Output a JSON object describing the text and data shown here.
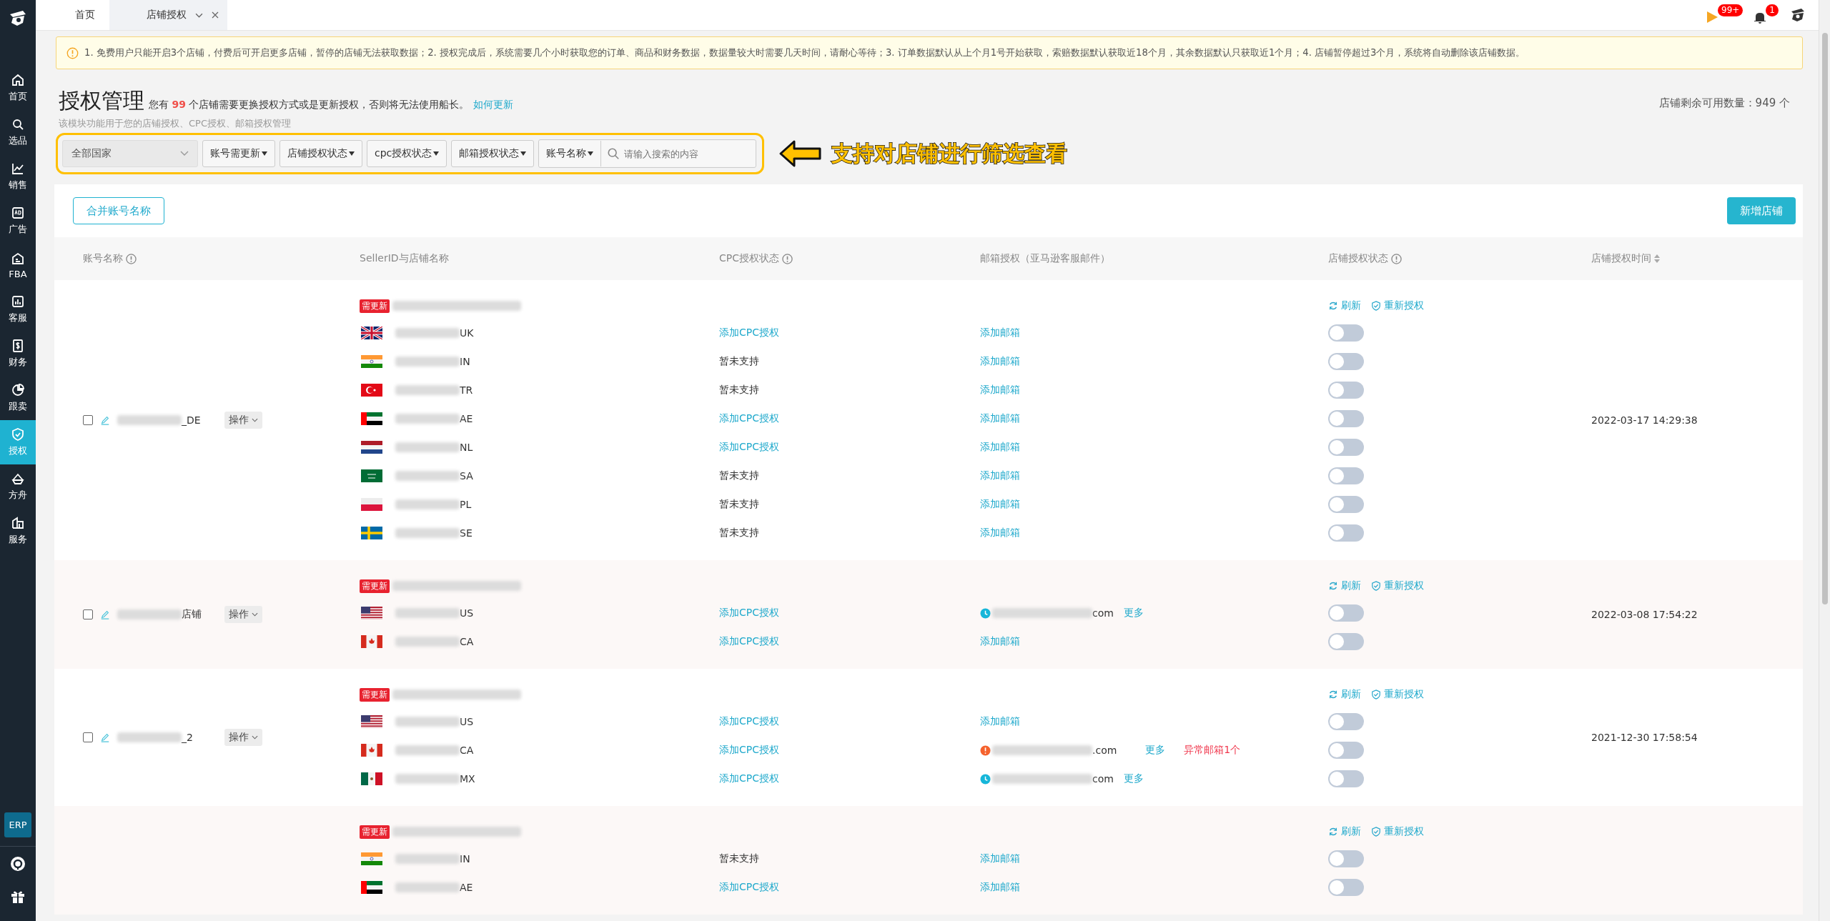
{
  "sidebar": {
    "items": [
      {
        "label": "首页",
        "selected": false
      },
      {
        "label": "选品",
        "selected": false
      },
      {
        "label": "销售",
        "selected": false
      },
      {
        "label": "广告",
        "selected": false
      },
      {
        "label": "FBA",
        "selected": false
      },
      {
        "label": "客服",
        "selected": false
      },
      {
        "label": "财务",
        "selected": false
      },
      {
        "label": "跟卖",
        "selected": false
      },
      {
        "label": "授权",
        "selected": true
      },
      {
        "label": "方舟",
        "selected": false
      },
      {
        "label": "服务",
        "selected": false
      }
    ],
    "erp": "ERP"
  },
  "tabs": [
    {
      "label": "首页",
      "selected": false
    },
    {
      "label": "店铺授权",
      "selected": true
    }
  ],
  "topbar": {
    "flag_badge": "99+",
    "bell_badge": "1"
  },
  "notice": "1. 免费用户只能开启3个店铺，付费后可开启更多店铺，暂停的店铺无法获取数据；2. 授权完成后，系统需要几个小时获取您的订单、商品和财务数据，数据量较大时需要几天时间，请耐心等待；3. 订单数据默认从上个月1号开始获取，索赔数据默认获取近18个月，其余数据默认只获取近1个月；4. 店铺暂停超过3个月，系统将自动删除该店铺数据。",
  "header": {
    "title": "授权管理",
    "message": "您有 **99** 个店铺需要更换授权方式或是更新授权，否则将无法使用船长。",
    "link": "如何更新",
    "description": "该模块功能用于您的店铺授权、CPC授权、邮箱授权管理",
    "quota": "店铺剩余可用数量：949 个"
  },
  "filters": {
    "country": "全部国家",
    "dropdowns": [
      "账号需更新",
      "店铺授权状态",
      "cpc授权状态",
      "邮箱授权状态"
    ],
    "search_scope": "账号名称",
    "search_placeholder": "请输入搜索的内容"
  },
  "annotation": "支持对店铺进行筛选查看",
  "buttons": {
    "merge": "合并账号名称",
    "add": "新增店铺"
  },
  "table": {
    "columns": [
      {
        "label": "账号名称",
        "kind": "info"
      },
      {
        "label": "SellerID与店铺名称",
        "kind": "plain"
      },
      {
        "label": "CPC授权状态",
        "kind": "info"
      },
      {
        "label": "邮箱授权（亚马逊客服邮件）",
        "kind": "plain"
      },
      {
        "label": "店铺授权状态",
        "kind": "info"
      },
      {
        "label": "店铺授权时间",
        "kind": "sort"
      }
    ]
  },
  "accounts": [
    {
      "selected": false,
      "name_suffix": "_DE",
      "action": "操作",
      "badge": "需更新",
      "refresh": "刷新",
      "reauth": "重新授权",
      "time": "2022-03-17 14:29:38",
      "shops": [
        {
          "kind": "uk",
          "suffix": "UK",
          "cpc": {
            "kind": "link",
            "text": "添加CPC授权"
          },
          "mail": {
            "kind": "add",
            "text": "添加邮箱"
          },
          "on": false
        },
        {
          "kind": "in",
          "suffix": "IN",
          "cpc": {
            "kind": "text",
            "text": "暂未支持"
          },
          "mail": {
            "kind": "add",
            "text": "添加邮箱"
          },
          "on": false
        },
        {
          "kind": "tr",
          "suffix": "TR",
          "cpc": {
            "kind": "text",
            "text": "暂未支持"
          },
          "mail": {
            "kind": "add",
            "text": "添加邮箱"
          },
          "on": false
        },
        {
          "kind": "ae",
          "suffix": "AE",
          "cpc": {
            "kind": "link",
            "text": "添加CPC授权"
          },
          "mail": {
            "kind": "add",
            "text": "添加邮箱"
          },
          "on": false
        },
        {
          "kind": "nl",
          "suffix": "NL",
          "cpc": {
            "kind": "link",
            "text": "添加CPC授权"
          },
          "mail": {
            "kind": "add",
            "text": "添加邮箱"
          },
          "on": false
        },
        {
          "kind": "sa",
          "suffix": "SA",
          "cpc": {
            "kind": "text",
            "text": "暂未支持"
          },
          "mail": {
            "kind": "add",
            "text": "添加邮箱"
          },
          "on": false
        },
        {
          "kind": "pl",
          "suffix": "PL",
          "cpc": {
            "kind": "text",
            "text": "暂未支持"
          },
          "mail": {
            "kind": "add",
            "text": "添加邮箱"
          },
          "on": false
        },
        {
          "kind": "se",
          "suffix": "SE",
          "cpc": {
            "kind": "text",
            "text": "暂未支持"
          },
          "mail": {
            "kind": "add",
            "text": "添加邮箱"
          },
          "on": false
        }
      ]
    },
    {
      "selected": false,
      "name_suffix": "店铺",
      "action": "操作",
      "badge": "需更新",
      "refresh": "刷新",
      "reauth": "重新授权",
      "time": "2022-03-08 17:54:22",
      "shops": [
        {
          "kind": "us",
          "suffix": "US",
          "cpc": {
            "kind": "link",
            "text": "添加CPC授权"
          },
          "mail": {
            "kind": "pending",
            "suffix": "com",
            "more": "更多"
          },
          "on": false
        },
        {
          "kind": "ca",
          "suffix": "CA",
          "cpc": {
            "kind": "link",
            "text": "添加CPC授权"
          },
          "mail": {
            "kind": "add",
            "text": "添加邮箱"
          },
          "on": false
        }
      ]
    },
    {
      "selected": false,
      "name_suffix": "_2",
      "action": "操作",
      "badge": "需更新",
      "refresh": "刷新",
      "reauth": "重新授权",
      "time": "2021-12-30 17:58:54",
      "shops": [
        {
          "kind": "us",
          "suffix": "US",
          "cpc": {
            "kind": "link",
            "text": "添加CPC授权"
          },
          "mail": {
            "kind": "add",
            "text": "添加邮箱"
          },
          "on": false
        },
        {
          "kind": "ca",
          "suffix": "CA",
          "cpc": {
            "kind": "link",
            "text": "添加CPC授权"
          },
          "mail": {
            "kind": "error",
            "suffix": ".com",
            "more": "更多",
            "warning": "异常邮箱1个"
          },
          "on": false
        },
        {
          "kind": "mx",
          "suffix": "MX",
          "cpc": {
            "kind": "link",
            "text": "添加CPC授权"
          },
          "mail": {
            "kind": "pending",
            "suffix": "com",
            "more": "更多"
          },
          "on": false
        }
      ]
    },
    {
      "badge": "需更新",
      "refresh": "刷新",
      "reauth": "重新授权",
      "shops": [
        {
          "kind": "in",
          "suffix": "IN",
          "cpc": {
            "kind": "text",
            "text": "暂未支持"
          },
          "mail": {
            "kind": "add",
            "text": "添加邮箱"
          },
          "on": false
        },
        {
          "kind": "ae",
          "suffix": "AE",
          "cpc": {
            "kind": "link",
            "text": "添加CPC授权"
          },
          "mail": {
            "kind": "add",
            "text": "添加邮箱"
          },
          "on": false
        }
      ]
    }
  ]
}
